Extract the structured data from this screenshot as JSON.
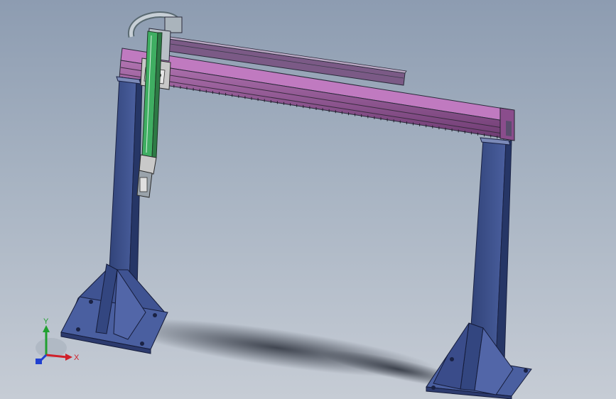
{
  "viewport": {
    "background_top": "#8d9cb1",
    "background_bottom": "#c6ccd5"
  },
  "model": {
    "frame_color": "#3b4f8a",
    "beam_color": "#8a4d8c",
    "rail_color": "#2f9a52",
    "carriage_color": "#c9c9c9"
  },
  "triad": {
    "x_label": "X",
    "y_label": "Y",
    "x_color": "#d0202a",
    "y_color": "#20a030",
    "z_color": "#2040d0"
  }
}
